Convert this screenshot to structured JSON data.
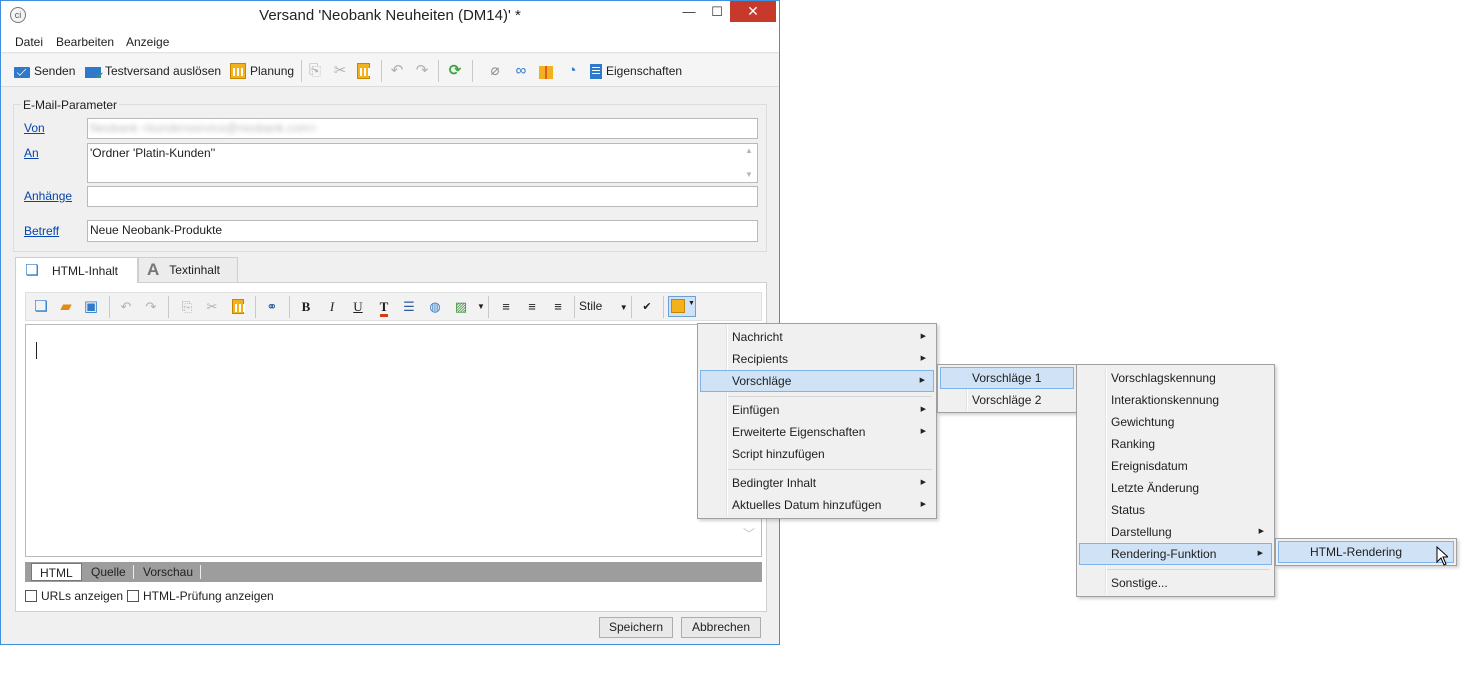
{
  "window": {
    "title": "Versand 'Neobank Neuheiten (DM14)' *",
    "app_icon": "adobe-campaign-icon",
    "controls": {
      "minimize": "—",
      "maximize": "☐",
      "close": "✕"
    }
  },
  "menubar": [
    "Datei",
    "Bearbeiten",
    "Anzeige"
  ],
  "toolbar": {
    "send": "Senden",
    "test": "Testversand auslösen",
    "schedule": "Planung",
    "properties": "Eigenschaften"
  },
  "params": {
    "group_title": "E-Mail-Parameter",
    "from_label": "Von",
    "from_value": "Neobank <kundenservice@neobank.com>",
    "to_label": "An",
    "to_value": "'Ordner 'Platin-Kunden''",
    "attachments_label": "Anhänge",
    "attachments_value": "",
    "subject_label": "Betreff",
    "subject_value": "Neue Neobank-Produkte"
  },
  "tabs": {
    "html": "HTML-Inhalt",
    "text": "Textinhalt",
    "text_glyph": "A"
  },
  "editor_toolbar": {
    "bold": "B",
    "italic": "I",
    "underline": "U",
    "styles": "Stile"
  },
  "modes": [
    "HTML",
    "Quelle",
    "Vorschau"
  ],
  "options": {
    "show_urls": "URLs anzeigen",
    "html_check": "HTML-Prüfung anzeigen"
  },
  "buttons": {
    "save": "Speichern",
    "cancel": "Abbrechen"
  },
  "context_menu": {
    "items": [
      "Nachricht",
      "Recipients",
      "Vorschläge",
      "Einfügen",
      "Erweiterte Eigenschaften",
      "Script hinzufügen",
      "Bedingter Inhalt",
      "Aktuelles Datum hinzufügen"
    ],
    "selected": "Vorschläge"
  },
  "submenu_offers": {
    "items": [
      "Vorschläge 1",
      "Vorschläge 2"
    ],
    "selected": "Vorschläge 1"
  },
  "submenu_offer_fields": {
    "items": [
      "Vorschlagskennung",
      "Interaktionskennung",
      "Gewichtung",
      "Ranking",
      "Ereignisdatum",
      "Letzte Änderung",
      "Status",
      "Darstellung",
      "Rendering-Funktion",
      "Sonstige..."
    ],
    "selected": "Rendering-Funktion"
  },
  "submenu_rendering": {
    "items": [
      "HTML-Rendering"
    ],
    "selected": "HTML-Rendering"
  },
  "colors": {
    "accent": "#3f90dc",
    "link": "#0645ad",
    "close": "#c7392b",
    "menu_highlight": "#d0e2f5"
  }
}
